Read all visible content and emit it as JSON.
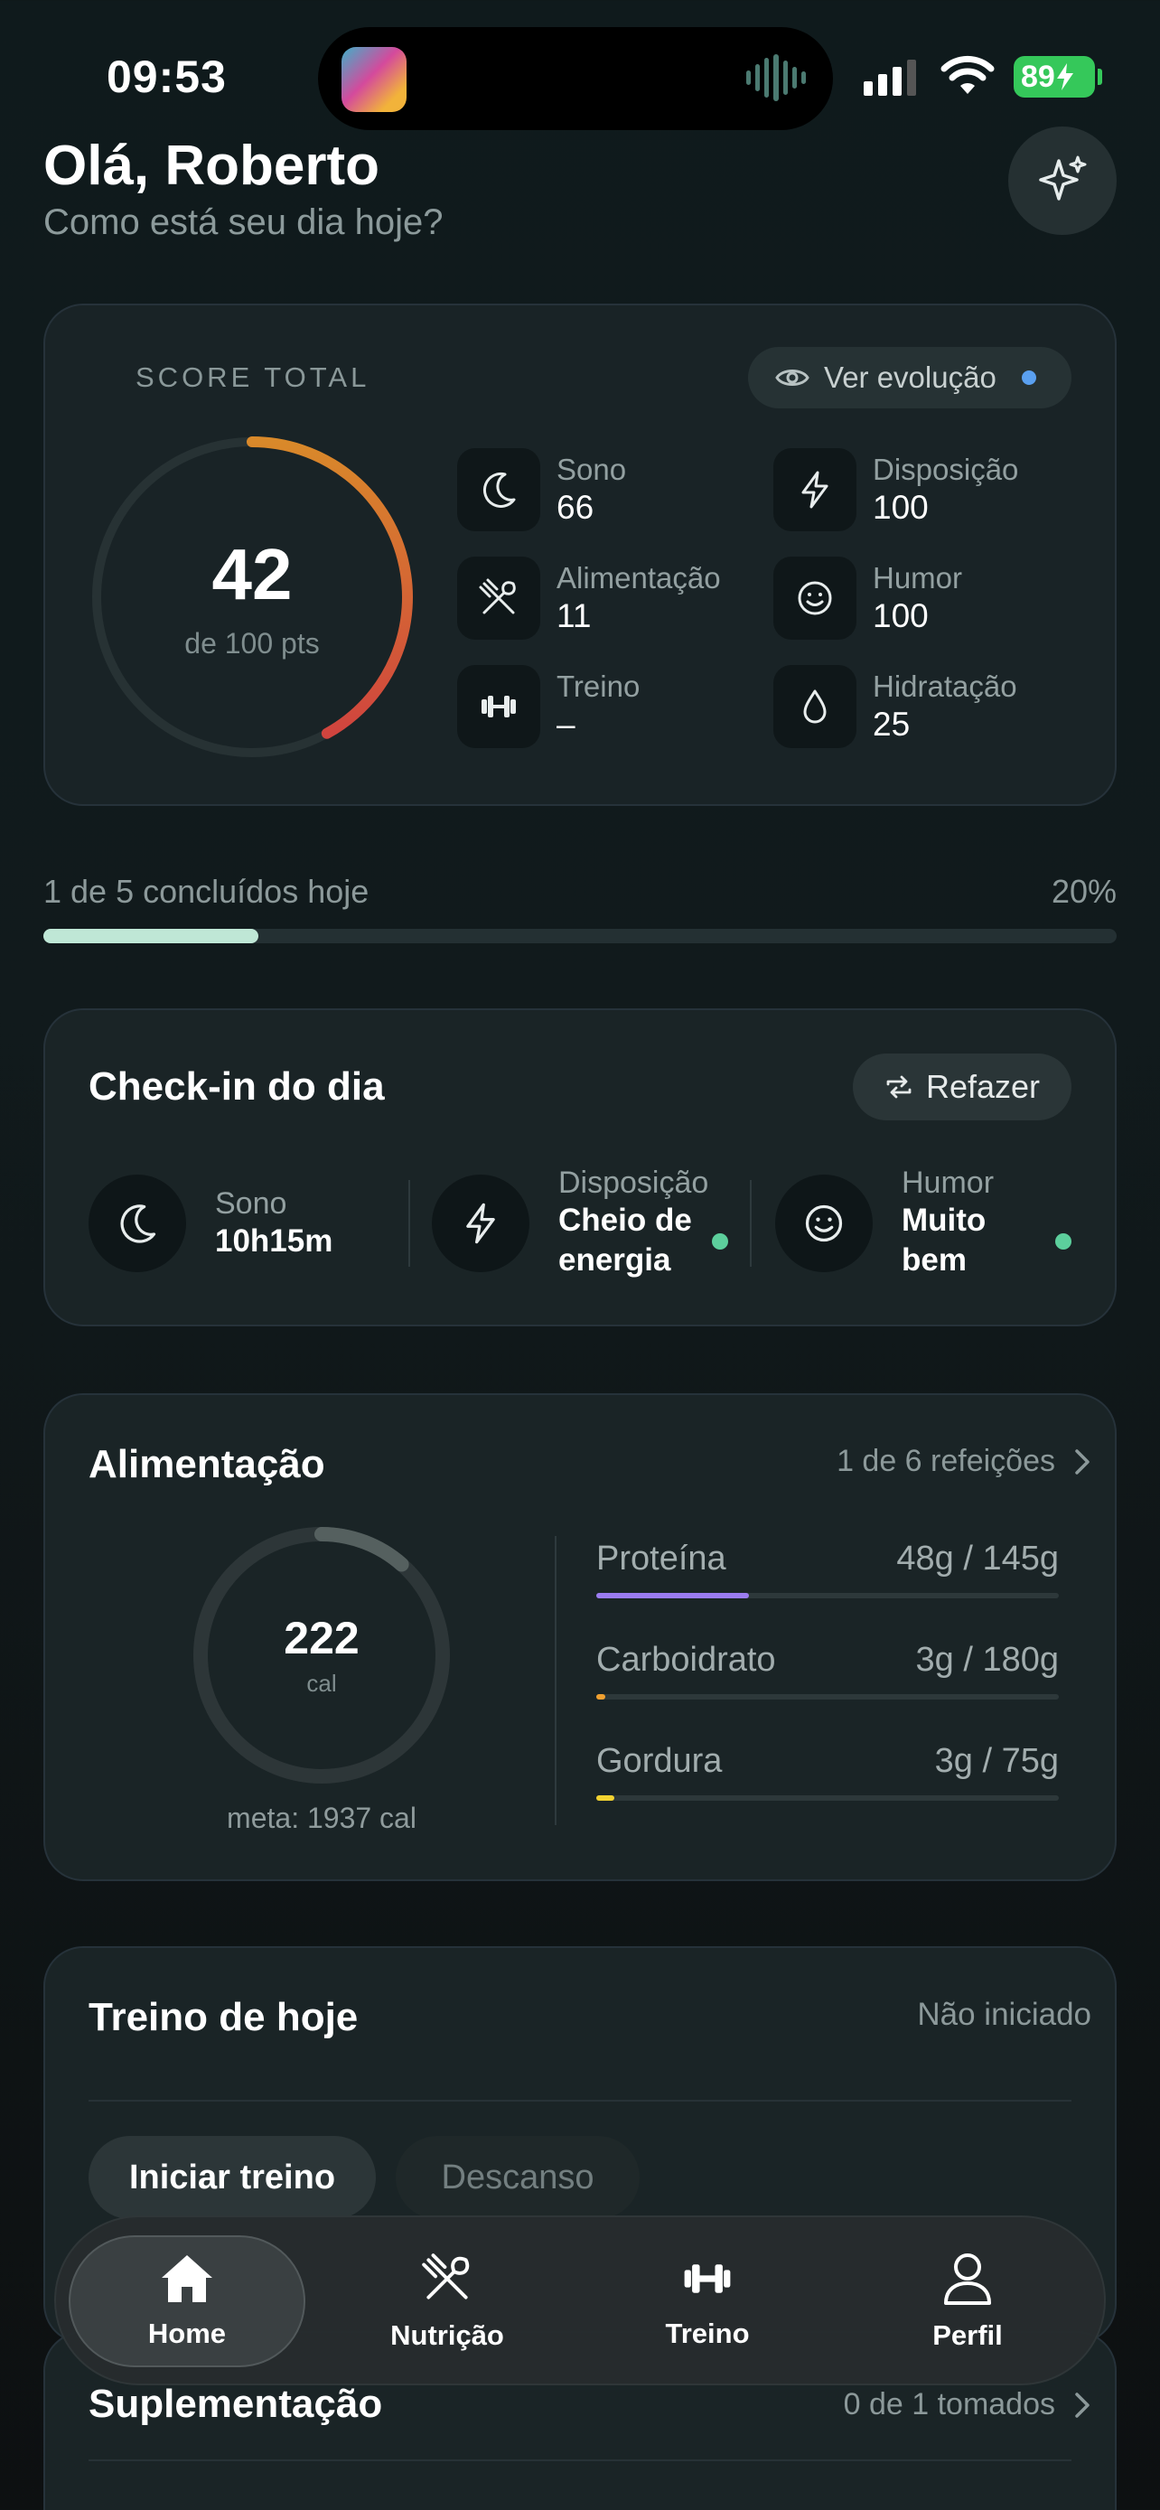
{
  "status_bar": {
    "time": "09:53",
    "battery": "89"
  },
  "header": {
    "greeting": "Olá, Roberto",
    "subtitle": "Como está seu dia hoje?"
  },
  "score": {
    "label": "SCORE TOTAL",
    "evolution_button": "Ver evolução",
    "value": "42",
    "of_text": "de 100 pts",
    "fraction": 0.42,
    "metrics": [
      {
        "name": "Sono",
        "value": "66",
        "icon": "moon-icon"
      },
      {
        "name": "Disposição",
        "value": "100",
        "icon": "bolt-icon"
      },
      {
        "name": "Alimentação",
        "value": "11",
        "icon": "utensils-icon"
      },
      {
        "name": "Humor",
        "value": "100",
        "icon": "smile-icon"
      },
      {
        "name": "Treino",
        "value": "–",
        "icon": "dumbbell-icon"
      },
      {
        "name": "Hidratação",
        "value": "25",
        "icon": "drop-icon"
      }
    ]
  },
  "progress": {
    "label": "1 de 5 concluídos hoje",
    "percent_text": "20%",
    "fraction": 0.2
  },
  "checkin": {
    "title": "Check-in do dia",
    "redo_button": "Refazer",
    "items": [
      {
        "name": "Sono",
        "value": "10h15m"
      },
      {
        "name": "Disposição",
        "value_line1": "Cheio de",
        "value_line2": "energia"
      },
      {
        "name": "Humor",
        "value_line1": "Muito",
        "value_line2": "bem"
      }
    ]
  },
  "nutrition": {
    "title": "Alimentação",
    "meals_link": "1 de 6 refeições",
    "calories": "222",
    "calories_unit": "cal",
    "goal": "meta: 1937 cal",
    "calories_fraction": 0.115,
    "macros": [
      {
        "name": "Proteína",
        "value": "48g / 145g",
        "fraction": 0.33,
        "color": "#9b7cf0"
      },
      {
        "name": "Carboidrato",
        "value": "3g / 180g",
        "fraction": 0.02,
        "color": "#f0a030"
      },
      {
        "name": "Gordura",
        "value": "3g / 75g",
        "fraction": 0.04,
        "color": "#f2d230"
      }
    ]
  },
  "workout": {
    "title": "Treino de hoje",
    "status": "Não iniciado",
    "start_button": "Iniciar treino",
    "rest_button": "Descanso"
  },
  "supplements": {
    "title": "Suplementação",
    "taken_link": "0 de 1 tomados"
  },
  "tabbar": {
    "home": "Home",
    "nutrition": "Nutrição",
    "workout": "Treino",
    "profile": "Perfil"
  },
  "colors": {
    "gauge_start": "#d9892a",
    "gauge_end": "#d0443e",
    "accent_green": "#5ccf9c",
    "progress_fill": "#bfe7d6"
  }
}
